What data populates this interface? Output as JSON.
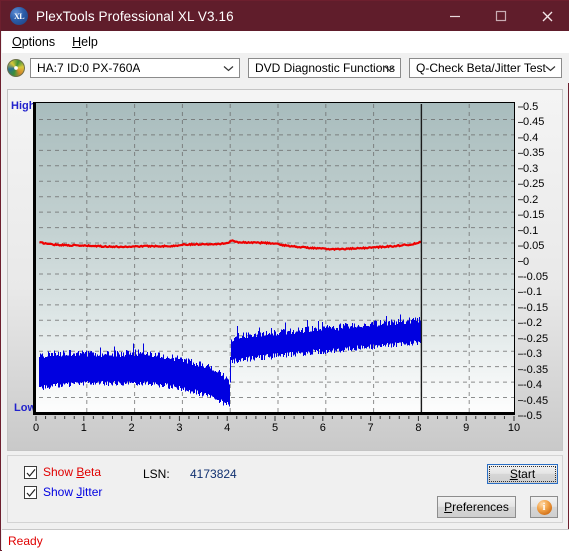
{
  "window": {
    "title": "PlexTools Professional XL V3.16",
    "icon": "xl-logo-icon",
    "minimize": "minimize-icon",
    "maximize": "maximize-icon",
    "close": "close-icon",
    "titlebar_color": "#601d2b"
  },
  "menubar": {
    "items": [
      {
        "label": "Options",
        "accel": "O"
      },
      {
        "label": "Help",
        "accel": "H"
      }
    ]
  },
  "toolbar": {
    "drive_icon": "optical-disc-icon",
    "drive": {
      "value": "HA:7 ID:0  PX-760A"
    },
    "function": {
      "value": "DVD Diagnostic Functions"
    },
    "test": {
      "value": "Q-Check Beta/Jitter Test"
    }
  },
  "chart_data": {
    "type": "line",
    "title": "Q-Check Beta/Jitter Test",
    "xlabel": "",
    "ylabel": "",
    "xlim": [
      0,
      10
    ],
    "ylim": [
      -0.5,
      0.5
    ],
    "xticks": [
      0,
      1,
      2,
      3,
      4,
      5,
      6,
      7,
      8,
      9,
      10
    ],
    "yticks": [
      0.5,
      0.45,
      0.4,
      0.35,
      0.3,
      0.25,
      0.2,
      0.15,
      0.1,
      0.05,
      0,
      -0.05,
      -0.1,
      -0.15,
      -0.2,
      -0.25,
      -0.3,
      -0.35,
      -0.4,
      -0.45,
      -0.5
    ],
    "ytick_labels": [
      "0.5",
      "0.45",
      "0.4",
      "0.35",
      "0.3",
      "0.25",
      "0.2",
      "0.15",
      "0.1",
      "0.05",
      "0",
      "-0.05",
      "-0.1",
      "-0.15",
      "-0.2",
      "-0.25",
      "-0.3",
      "-0.35",
      "-0.4",
      "-0.45",
      "-0.5"
    ],
    "left_axis_top_label": "High",
    "left_axis_bottom_label": "Low",
    "grid": true,
    "grid_style": "dashed",
    "legend": [
      "Show Beta",
      "Show Jitter"
    ],
    "data_end_marker_x": 8.0,
    "series": [
      {
        "name": "Beta",
        "color": "#ee0000",
        "type": "line",
        "x": [
          0.0,
          0.2,
          0.4,
          0.6,
          0.8,
          1.0,
          1.2,
          1.4,
          1.6,
          1.8,
          2.0,
          2.2,
          2.4,
          2.6,
          2.8,
          3.0,
          3.2,
          3.4,
          3.6,
          3.8,
          3.95,
          4.0,
          4.2,
          4.4,
          4.6,
          4.8,
          5.0,
          5.2,
          5.4,
          5.6,
          5.8,
          6.0,
          6.2,
          6.4,
          6.6,
          6.8,
          7.0,
          7.2,
          7.4,
          7.6,
          7.8,
          7.95
        ],
        "values": [
          0.052,
          0.047,
          0.044,
          0.043,
          0.042,
          0.041,
          0.04,
          0.039,
          0.038,
          0.038,
          0.039,
          0.04,
          0.04,
          0.04,
          0.04,
          0.045,
          0.046,
          0.046,
          0.047,
          0.048,
          0.05,
          0.058,
          0.052,
          0.052,
          0.051,
          0.05,
          0.046,
          0.041,
          0.038,
          0.035,
          0.033,
          0.031,
          0.03,
          0.031,
          0.032,
          0.034,
          0.036,
          0.038,
          0.04,
          0.043,
          0.046,
          0.052
        ]
      },
      {
        "name": "Jitter",
        "color": "#0000e0",
        "type": "band",
        "x": [
          0.0,
          0.25,
          0.5,
          0.75,
          1.0,
          1.25,
          1.5,
          1.75,
          2.0,
          2.25,
          2.5,
          2.75,
          3.0,
          3.25,
          3.5,
          3.75,
          3.9,
          3.99,
          4.0,
          4.1,
          4.25,
          4.5,
          4.75,
          5.0,
          5.25,
          5.5,
          5.75,
          6.0,
          6.25,
          6.5,
          6.75,
          7.0,
          7.25,
          7.5,
          7.75,
          7.95
        ],
        "upper": [
          -0.318,
          -0.312,
          -0.31,
          -0.31,
          -0.31,
          -0.312,
          -0.312,
          -0.312,
          -0.308,
          -0.312,
          -0.316,
          -0.322,
          -0.33,
          -0.34,
          -0.352,
          -0.372,
          -0.392,
          -0.404,
          -0.268,
          -0.258,
          -0.252,
          -0.248,
          -0.246,
          -0.244,
          -0.24,
          -0.236,
          -0.232,
          -0.23,
          -0.226,
          -0.222,
          -0.218,
          -0.214,
          -0.212,
          -0.208,
          -0.204,
          -0.2
        ],
        "lower": [
          -0.42,
          -0.412,
          -0.408,
          -0.406,
          -0.404,
          -0.404,
          -0.404,
          -0.404,
          -0.402,
          -0.404,
          -0.408,
          -0.414,
          -0.422,
          -0.432,
          -0.444,
          -0.458,
          -0.47,
          -0.478,
          -0.336,
          -0.33,
          -0.326,
          -0.322,
          -0.318,
          -0.314,
          -0.31,
          -0.306,
          -0.302,
          -0.3,
          -0.296,
          -0.292,
          -0.288,
          -0.286,
          -0.282,
          -0.278,
          -0.274,
          -0.27
        ]
      }
    ]
  },
  "controls": {
    "show_beta": {
      "label_pre": "Show ",
      "accel": "B",
      "label_post": "eta",
      "checked": true,
      "color": "#e00000"
    },
    "show_jitter": {
      "label_pre": "Show ",
      "accel": "J",
      "label_post": "itter",
      "checked": true,
      "color": "#0000e0"
    },
    "lsn_label": "LSN:",
    "lsn_value": "4173824",
    "start": {
      "label_pre": "",
      "accel": "S",
      "label_post": "tart",
      "focused": true
    },
    "preferences": {
      "label_pre": "",
      "accel": "P",
      "label_post": "references"
    },
    "info": {
      "icon": "info-icon"
    }
  },
  "statusbar": {
    "text": "Ready",
    "color": "#e00000"
  }
}
